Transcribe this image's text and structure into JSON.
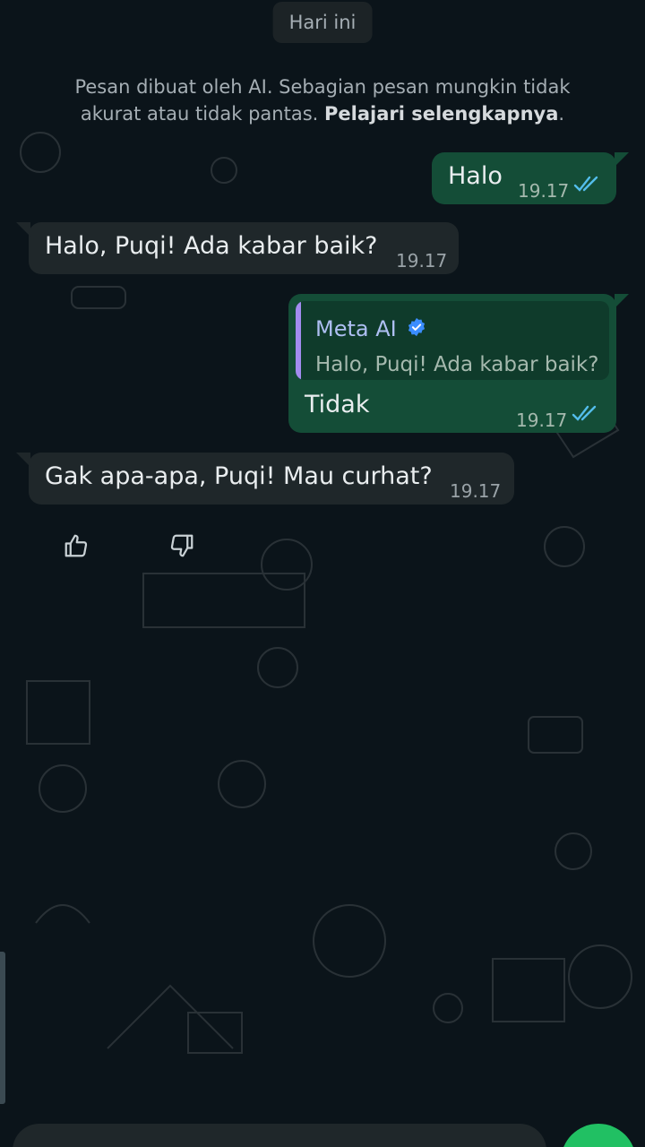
{
  "date_chip": "Hari ini",
  "ai_notice": {
    "line1": "Pesan dibuat oleh AI. Sebagian pesan mungkin tidak",
    "line2_prefix": "akurat atau tidak pantas. ",
    "learn_more": "Pelajari selengkapnya",
    "line2_suffix": "."
  },
  "messages": [
    {
      "direction": "outgoing",
      "text": "Halo",
      "time": "19.17",
      "status": "read"
    },
    {
      "direction": "incoming",
      "text": "Halo, Puqi! Ada kabar baik?",
      "time": "19.17"
    },
    {
      "direction": "outgoing",
      "text": "Tidak",
      "time": "19.17",
      "status": "read",
      "quote": {
        "author": "Meta AI",
        "text": "Halo, Puqi! Ada kabar baik?"
      }
    },
    {
      "direction": "incoming",
      "text": "Gak apa-apa, Puqi! Mau curhat?",
      "time": "19.17"
    }
  ],
  "reactions": {
    "like_icon": "thumbs-up-icon",
    "dislike_icon": "thumbs-down-icon"
  },
  "colors": {
    "background": "#0b141a",
    "outgoing_bubble": "#144d37",
    "incoming_bubble": "#1f272a",
    "read_ticks": "#53bdeb",
    "quote_bar": "#a38cf0",
    "send_button": "#21c063"
  }
}
